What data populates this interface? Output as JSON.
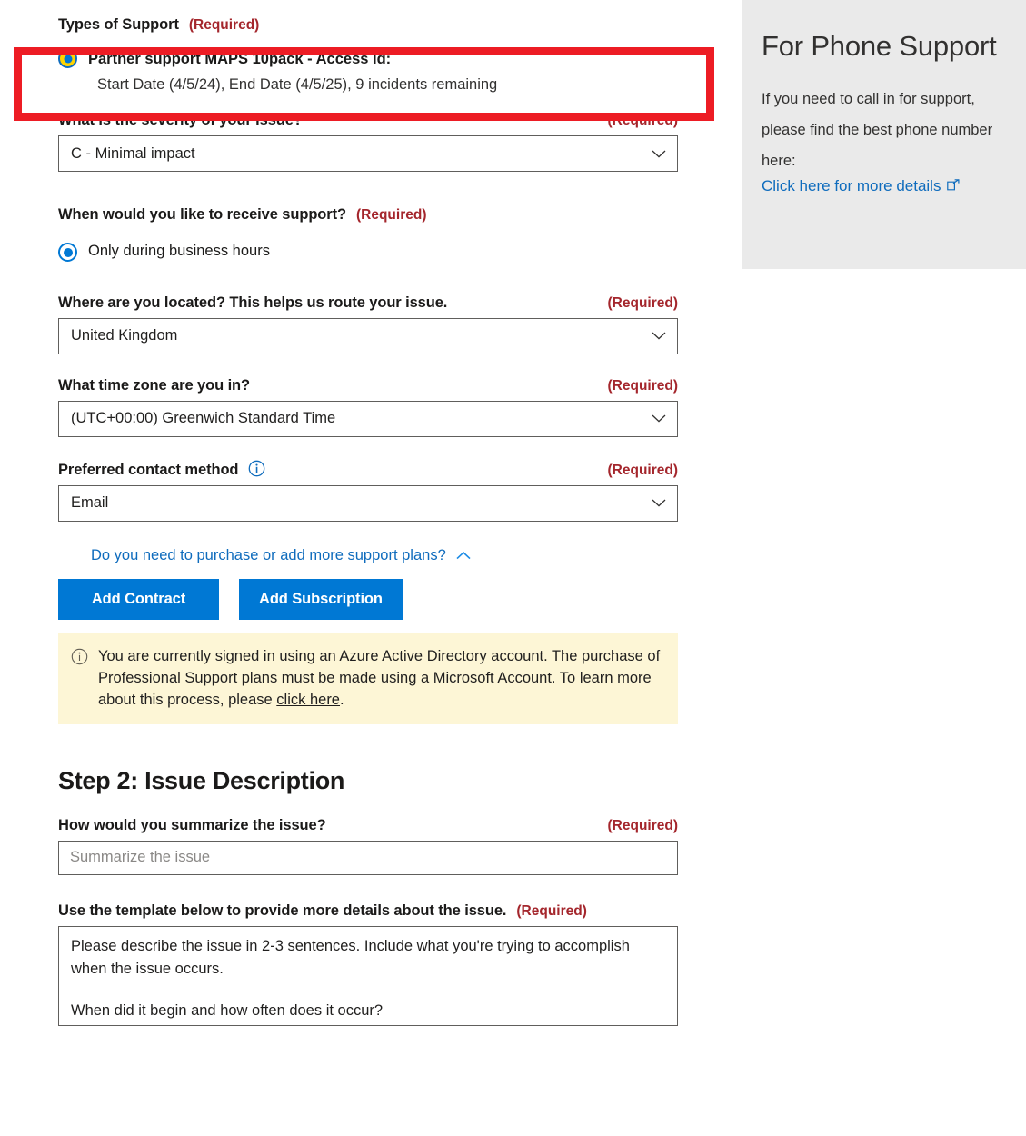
{
  "form": {
    "types_of_support": {
      "label": "Types of Support",
      "required": "(Required)",
      "option": {
        "title": "Partner support MAPS 10pack - Access Id:",
        "detail": "Start Date (4/5/24), End Date (4/5/25), 9 incidents remaining",
        "selected": true
      }
    },
    "severity": {
      "label": "What is the severity of your issue?",
      "required": "(Required)",
      "value": "C - Minimal impact"
    },
    "when_support": {
      "label": "When would you like to receive support?",
      "required": "(Required)",
      "option": "Only during business hours"
    },
    "location": {
      "label": "Where are you located? This helps us route your issue.",
      "required": "(Required)",
      "value": "United Kingdom"
    },
    "timezone": {
      "label": "What time zone are you in?",
      "required": "(Required)",
      "value": "(UTC+00:00) Greenwich Standard Time"
    },
    "contact_method": {
      "label": "Preferred contact method",
      "required": "(Required)",
      "value": "Email",
      "info_icon": "info-circle-icon"
    },
    "expander": {
      "text": "Do you need to purchase or add more support plans?",
      "icon": "chevron-up-icon"
    },
    "buttons": {
      "add_contract": "Add Contract",
      "add_subscription": "Add Subscription"
    },
    "notice": {
      "icon": "info-circle-icon",
      "text": "You are currently signed in using an Azure Active Directory account. The purchase of Professional Support plans must be made using a Microsoft Account. To learn more about this process, please ",
      "link": "click here",
      "tail": "."
    }
  },
  "step2": {
    "heading": "Step 2: Issue Description",
    "summary": {
      "label": "How would you summarize the issue?",
      "required": "(Required)",
      "value": "",
      "placeholder": "Summarize the issue"
    },
    "details": {
      "label": "Use the template below to provide more details about the issue.",
      "required": "(Required)",
      "line1": "Please describe the issue in 2-3 sentences. Include what you're trying to accomplish when the issue occurs.",
      "line2": "When did it begin and how often does it occur?"
    }
  },
  "side_panel": {
    "title": "For Phone Support",
    "body": "If you need to call in for support, please find the best phone number here:",
    "link": "Click here for more details",
    "link_icon": "external-link-icon"
  },
  "colors": {
    "accent_blue": "#0078d4",
    "link_blue": "#0f6cbd",
    "required_red": "#a4262c",
    "highlight_red": "#ed1c24",
    "notice_yellow": "#fdf6d6",
    "panel_grey": "#eaeaea",
    "focus_gold": "#ffd400"
  }
}
